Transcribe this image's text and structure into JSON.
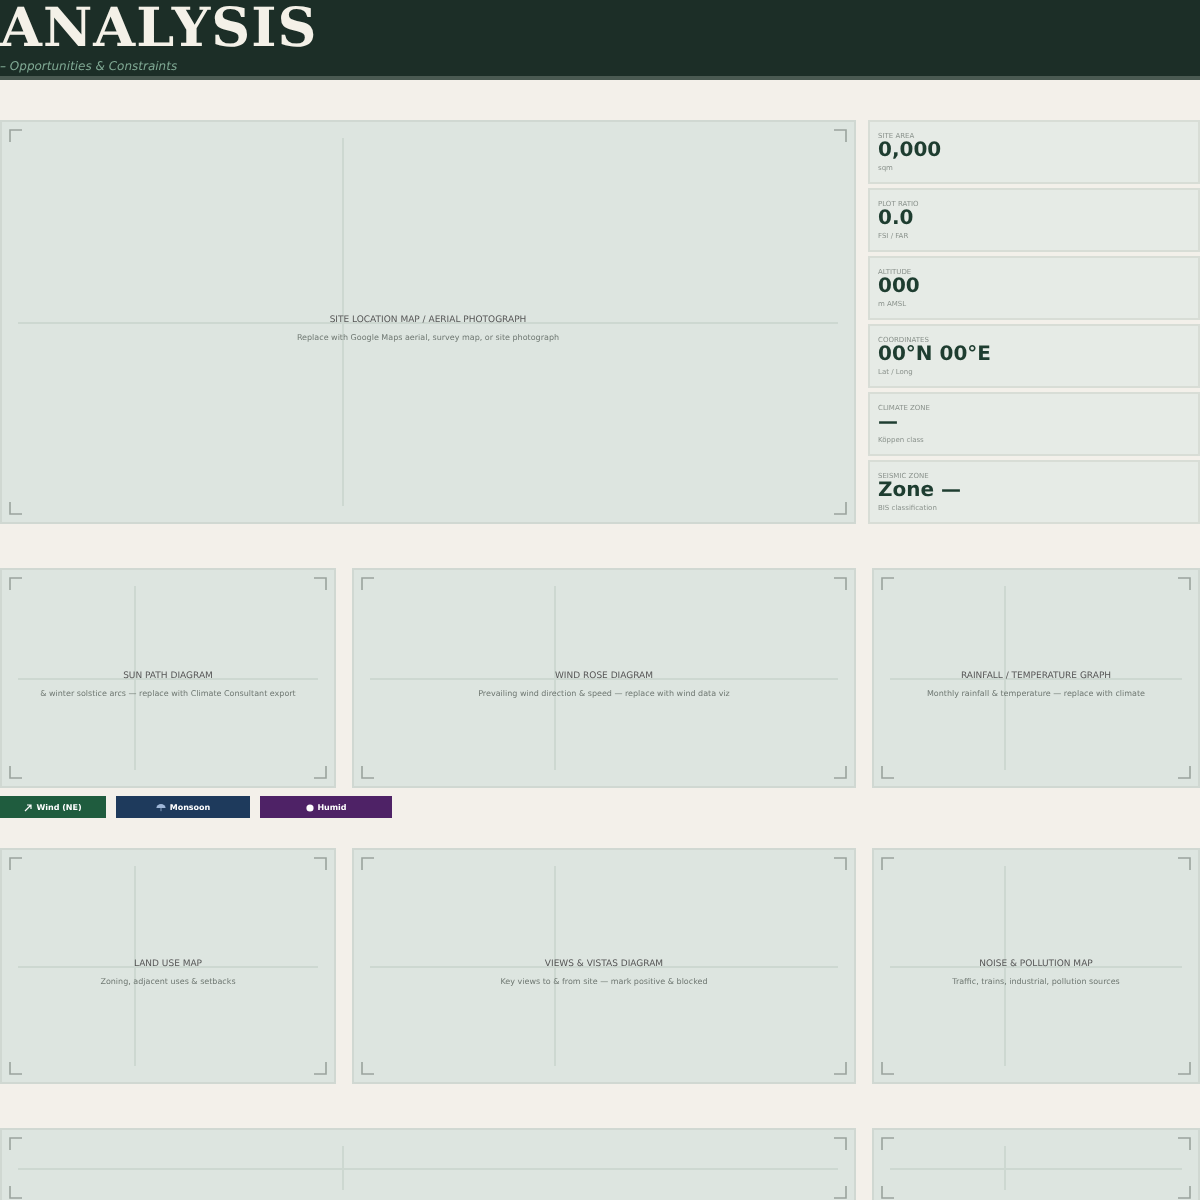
{
  "header": {
    "title": "ANALYSIS",
    "subtitle": "– Opportunities & Constraints"
  },
  "site_map": {
    "title": "SITE LOCATION MAP / AERIAL PHOTOGRAPH",
    "hint": "Replace with Google Maps aerial, survey map, or site photograph"
  },
  "stats": [
    {
      "label": "SITE AREA",
      "value": "0,000",
      "unit": "sqm"
    },
    {
      "label": "PLOT RATIO",
      "value": "0.0",
      "unit": "FSI / FAR"
    },
    {
      "label": "ALTITUDE",
      "value": "000",
      "unit": "m AMSL"
    },
    {
      "label": "COORDINATES",
      "value": "00°N 00°E",
      "unit": "Lat / Long"
    },
    {
      "label": "CLIMATE ZONE",
      "value": "—",
      "unit": "Köppen class"
    },
    {
      "label": "SEISMIC ZONE",
      "value": "Zone —",
      "unit": "BIS classification"
    }
  ],
  "climate_panels": [
    {
      "title": "SUN PATH DIAGRAM",
      "hint": "& winter solstice arcs — replace with Climate Consultant export"
    },
    {
      "title": "WIND ROSE DIAGRAM",
      "hint": "Prevailing wind direction & speed — replace with wind data viz"
    },
    {
      "title": "RAINFALL / TEMPERATURE GRAPH",
      "hint": "Monthly rainfall & temperature — replace with climate"
    }
  ],
  "chips": [
    {
      "kind": "wind",
      "label": "Wind (NE)",
      "color": "#1f5c3e"
    },
    {
      "kind": "rain",
      "label": "Monsoon",
      "color": "#1e3a5c"
    },
    {
      "kind": "humid",
      "label": "Humid",
      "color": "#4e2266"
    }
  ],
  "context_panels": [
    {
      "title": "LAND USE MAP",
      "hint": "Zoning, adjacent uses & setbacks"
    },
    {
      "title": "VIEWS & VISTAS DIAGRAM",
      "hint": "Key views to & from site — mark positive & blocked"
    },
    {
      "title": "NOISE & POLLUTION MAP",
      "hint": "Traffic, trains, industrial, pollution sources"
    }
  ]
}
